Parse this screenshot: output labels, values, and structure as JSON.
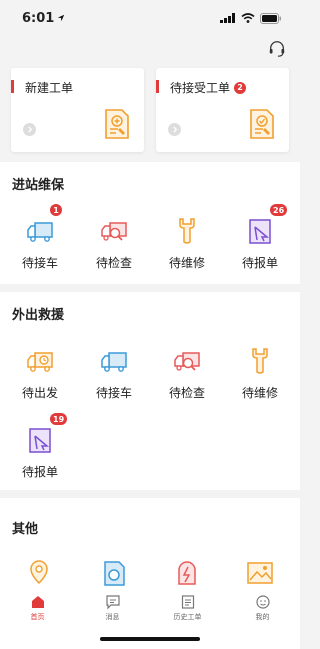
{
  "status_bar": {
    "time": "6:01"
  },
  "cards": [
    {
      "title": "新建工单",
      "badge": null
    },
    {
      "title": "待接受工单",
      "badge": "2"
    }
  ],
  "sections": {
    "station": {
      "title": "进站维保",
      "items": [
        {
          "label": "待接车",
          "badge": "1",
          "icon": "truck-icon"
        },
        {
          "label": "待检查",
          "badge": null,
          "icon": "inspect-truck-icon"
        },
        {
          "label": "待维修",
          "badge": null,
          "icon": "wrench-icon"
        },
        {
          "label": "待报单",
          "badge": "26",
          "icon": "report-icon"
        }
      ]
    },
    "rescue": {
      "title": "外出救援",
      "items": [
        {
          "label": "待出发",
          "badge": null,
          "icon": "truck-clock-icon"
        },
        {
          "label": "待接车",
          "badge": null,
          "icon": "truck-icon"
        },
        {
          "label": "待检查",
          "badge": null,
          "icon": "inspect-truck-icon"
        },
        {
          "label": "待维修",
          "badge": null,
          "icon": "wrench-icon"
        },
        {
          "label": "待报单",
          "badge": "19",
          "icon": "report-icon"
        }
      ]
    },
    "other": {
      "title": "其他",
      "items": [
        {
          "icon": "location-icon"
        },
        {
          "icon": "search-doc-icon"
        },
        {
          "icon": "alarm-icon"
        },
        {
          "icon": "image-icon"
        }
      ]
    }
  },
  "tabs": [
    {
      "label": "首页",
      "active": true,
      "icon": "home-icon"
    },
    {
      "label": "消息",
      "active": false,
      "icon": "message-icon"
    },
    {
      "label": "历史工单",
      "active": false,
      "icon": "history-icon"
    },
    {
      "label": "我的",
      "active": false,
      "icon": "profile-icon"
    }
  ],
  "colors": {
    "accent": "#e03a3a",
    "blue": "#3b9ad9",
    "orange": "#f0a030",
    "purple": "#7a4fd0",
    "red_icon": "#e85a5a"
  }
}
